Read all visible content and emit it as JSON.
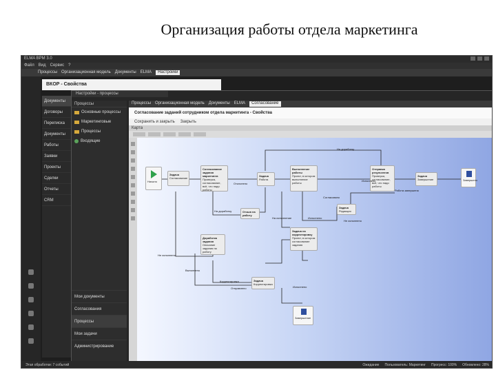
{
  "slide": {
    "title": "Организация работы отдела маркетинга"
  },
  "outer": {
    "window_title": "ELMA BPM 3.0",
    "menu": [
      "Файл",
      "Вид",
      "Сервис",
      "?"
    ],
    "tabs": [
      "Процессы",
      "Организационная модель",
      "Документы",
      "ELMA",
      "Настройки"
    ],
    "header": "ВКОР - Свойства",
    "nav": [
      "Документы",
      "Договоры",
      "Переписка",
      "Документы",
      "Работы",
      "Заявки",
      "Проекты",
      "Сделки",
      "Отчеты",
      "CRM"
    ]
  },
  "inner": {
    "window_title": "Настройки - процессы",
    "tabs": [
      "Процессы",
      "Организационная модель",
      "Документы",
      "ELMA",
      "Согласование"
    ],
    "sidebar_head": "Процессы",
    "sidebar_items": [
      "Основные процессы",
      "Маркетинговые",
      "Процессы",
      "Входящие"
    ],
    "sidebar_lower": [
      "Мои документы",
      "Согласования",
      "Процессы",
      "Мои задачи",
      "Администрирование"
    ],
    "header": "Согласование заданий сотрудником отдела маркетинга - Свойства",
    "actions": [
      "Сохранить и закрыть",
      "Закрыть"
    ],
    "strip": "Карта"
  },
  "diagram": {
    "start": "Начало",
    "tasks": [
      {
        "id": "t1",
        "title": "Задача",
        "sub": "Согласование"
      },
      {
        "id": "t2",
        "title": "Согласование задания маркетинга",
        "sub": "Проверка, согласование, всё, что надо работы"
      },
      {
        "id": "t3",
        "title": "Задача",
        "sub": "Работа"
      },
      {
        "id": "t4",
        "title": "Выполнение работы",
        "sub": "Проект, в котором выполнение работы"
      },
      {
        "id": "t5",
        "title": "Отправка результатов",
        "sub": "Проверка, согласование, всё, что надо работы"
      },
      {
        "id": "t6",
        "title": "Задача",
        "sub": "Завершение"
      },
      {
        "id": "t7",
        "title": "Отзыв на работу",
        "sub": ""
      },
      {
        "id": "t8",
        "title": "Задача",
        "sub": "Редакция"
      },
      {
        "id": "t9",
        "title": "Задача на корректировку",
        "sub": "Проект, в котором согласование задания"
      },
      {
        "id": "t10",
        "title": "Доработка задания",
        "sub": "Описание задания на работу"
      },
      {
        "id": "t11",
        "title": "Задача",
        "sub": "Корректировка"
      }
    ],
    "end_top": "Завершено",
    "end_bottom": "Завершение",
    "labels": [
      "На доработку",
      "На доработку",
      "Отклонено",
      "Работа завершена",
      "Согласовано",
      "На исполнение",
      "Исполнено",
      "Исполнено",
      "Не исполнено",
      "Не исполнено",
      "Выполнено",
      "Корректировка",
      "Отправлено",
      "Исполнено"
    ]
  },
  "status": {
    "left": "Этап обработки: 7 событий",
    "items": [
      "Ожидание",
      "Пользователь: Маркетинг",
      "Прогресс: 100%",
      "Обновлено: 28%"
    ]
  }
}
